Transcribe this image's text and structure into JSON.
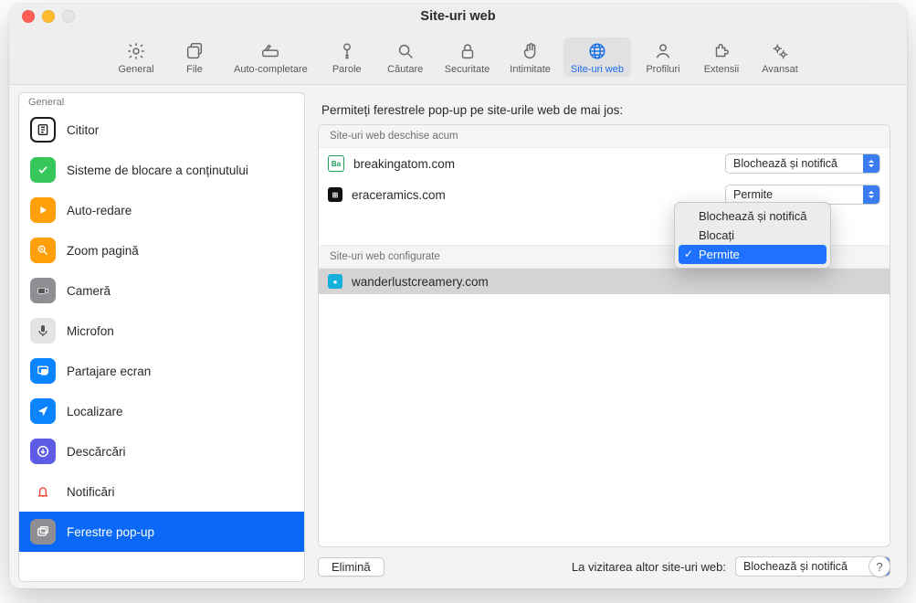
{
  "window": {
    "title": "Site-uri web"
  },
  "toolbar": {
    "items": [
      {
        "id": "general",
        "label": "General"
      },
      {
        "id": "file",
        "label": "File"
      },
      {
        "id": "autofill",
        "label": "Auto-completare"
      },
      {
        "id": "passwords",
        "label": "Parole"
      },
      {
        "id": "search",
        "label": "Căutare"
      },
      {
        "id": "security",
        "label": "Securitate"
      },
      {
        "id": "privacy",
        "label": "Intimitate"
      },
      {
        "id": "websites",
        "label": "Site-uri web",
        "active": true
      },
      {
        "id": "profiles",
        "label": "Profiluri"
      },
      {
        "id": "extensions",
        "label": "Extensii"
      },
      {
        "id": "advanced",
        "label": "Avansat"
      }
    ]
  },
  "sidebar": {
    "group_label": "General",
    "items": [
      {
        "id": "reader",
        "label": "Cititor",
        "color": "#1d1d1d",
        "bg": "#ffffff",
        "border": "#1d1d1d"
      },
      {
        "id": "content-blockers",
        "label": "Sisteme de blocare a conținutului",
        "color": "#ffffff",
        "bg": "#35c759"
      },
      {
        "id": "autoplay",
        "label": "Auto-redare",
        "color": "#ffffff",
        "bg": "#ff9f0a"
      },
      {
        "id": "page-zoom",
        "label": "Zoom pagină",
        "color": "#ffffff",
        "bg": "#ff9f0a"
      },
      {
        "id": "camera",
        "label": "Cameră",
        "color": "#ffffff",
        "bg": "#8e8e93"
      },
      {
        "id": "microphone",
        "label": "Microfon",
        "color": "#555",
        "bg": "#e4e4e6"
      },
      {
        "id": "screen-sharing",
        "label": "Partajare ecran",
        "color": "#ffffff",
        "bg": "#0a84ff"
      },
      {
        "id": "location",
        "label": "Localizare",
        "color": "#ffffff",
        "bg": "#0a84ff"
      },
      {
        "id": "downloads",
        "label": "Descărcări",
        "color": "#ffffff",
        "bg": "#5e5ce6"
      },
      {
        "id": "notifications",
        "label": "Notificări",
        "color": "#ffffff",
        "bg": "#ffffff",
        "stroke": "#ff3b30"
      },
      {
        "id": "popups",
        "label": "Ferestre pop-up",
        "color": "#ffffff",
        "bg": "#8e8e93",
        "selected": true
      }
    ]
  },
  "main": {
    "heading": "Permiteți ferestrele pop-up pe site-urile web de mai jos:",
    "section_open_label": "Site-uri web deschise acum",
    "section_configured_label": "Site-uri web configurate",
    "open_sites": [
      {
        "domain": "breakingatom.com",
        "favicon_text": "Ba",
        "favicon_bg": "#ffffff",
        "favicon_border": "#1e9e5a",
        "favicon_color": "#1e9e5a",
        "policy": "Blochează și notifică"
      },
      {
        "domain": "eraceramics.com",
        "favicon_text": "⊞",
        "favicon_bg": "#111",
        "favicon_color": "#fff",
        "policy": "Permite",
        "menu_open": true
      }
    ],
    "configured_sites": [
      {
        "domain": "wanderlustcreamery.com",
        "favicon_text": "●",
        "favicon_bg": "#17b0dd",
        "favicon_color": "#fff",
        "selected": true
      }
    ],
    "menu_options": [
      {
        "label": "Blochează și notifică"
      },
      {
        "label": "Blocați"
      },
      {
        "label": "Permite",
        "checked": true,
        "highlight": true
      }
    ],
    "footer": {
      "remove_label": "Elimină",
      "others_label": "La vizitarea altor site-uri web:",
      "others_value": "Blochează și notifică"
    }
  },
  "help_label": "?"
}
